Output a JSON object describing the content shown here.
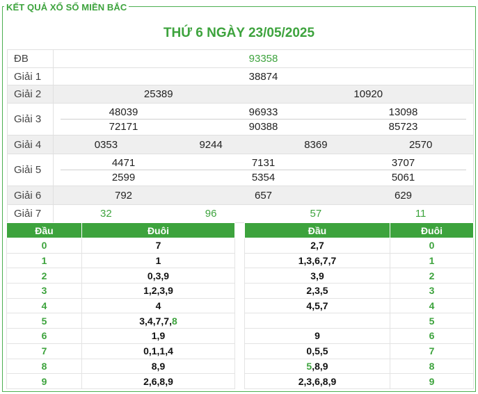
{
  "header": {
    "section_title": "KẾT QUẢ XỔ SỐ MIỀN BẮC",
    "date_title": "THỨ 6 NGÀY 23/05/2025"
  },
  "prizes": {
    "db": {
      "label": "ĐB",
      "values": [
        "93358"
      ]
    },
    "g1": {
      "label": "Giải 1",
      "values": [
        "38874"
      ]
    },
    "g2": {
      "label": "Giải 2",
      "values": [
        "25389",
        "10920"
      ]
    },
    "g3": {
      "label": "Giải 3",
      "row1": [
        "48039",
        "96933",
        "13098"
      ],
      "row2": [
        "72171",
        "90388",
        "85723"
      ]
    },
    "g4": {
      "label": "Giải 4",
      "values": [
        "0353",
        "9244",
        "8369",
        "2570"
      ]
    },
    "g5": {
      "label": "Giải 5",
      "row1": [
        "4471",
        "7131",
        "3707"
      ],
      "row2": [
        "2599",
        "5354",
        "5061"
      ]
    },
    "g6": {
      "label": "Giải 6",
      "values": [
        "792",
        "657",
        "629"
      ]
    },
    "g7": {
      "label": "Giải 7",
      "values": [
        "32",
        "96",
        "57",
        "11"
      ]
    }
  },
  "loto_head": {
    "header_dau": "Đầu",
    "header_duoi": "Đuôi",
    "rows": [
      {
        "num": "0",
        "val": "7"
      },
      {
        "num": "1",
        "val": "1"
      },
      {
        "num": "2",
        "val": "0,3,9"
      },
      {
        "num": "3",
        "val": "1,2,3,9"
      },
      {
        "num": "4",
        "val": "4"
      },
      {
        "num": "5",
        "val": "3,4,7,7,",
        "val_hl": "8"
      },
      {
        "num": "6",
        "val": "1,9"
      },
      {
        "num": "7",
        "val": "0,1,1,4"
      },
      {
        "num": "8",
        "val": "8,9"
      },
      {
        "num": "9",
        "val": "2,6,8,9"
      }
    ]
  },
  "loto_tail": {
    "header_dau": "Đầu",
    "header_duoi": "Đuôi",
    "rows": [
      {
        "val": "2,7",
        "num": "0"
      },
      {
        "val": "1,3,6,7,7",
        "num": "1"
      },
      {
        "val": "3,9",
        "num": "2"
      },
      {
        "val": "2,3,5",
        "num": "3"
      },
      {
        "val": "4,5,7",
        "num": "4"
      },
      {
        "val": "",
        "num": "5"
      },
      {
        "val": "9",
        "num": "6"
      },
      {
        "val": "0,5,5",
        "num": "7"
      },
      {
        "val_hl": "5",
        "val": ",8,9",
        "num": "8"
      },
      {
        "val": "2,3,6,8,9",
        "num": "9"
      }
    ]
  },
  "colors": {
    "accent": "#3da33d",
    "row_shade": "#efefef"
  }
}
